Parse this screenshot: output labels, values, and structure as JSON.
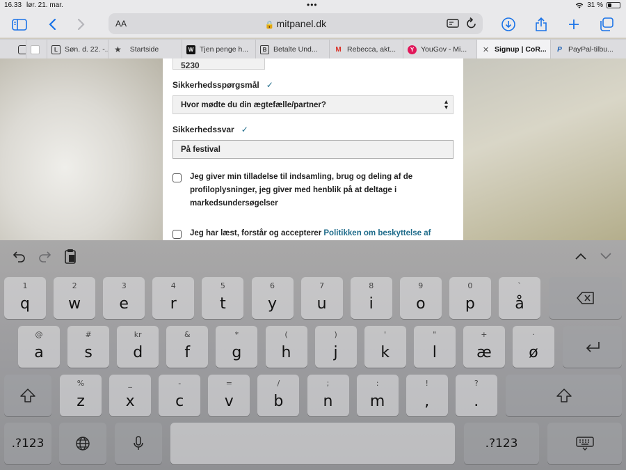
{
  "status": {
    "time": "16.33",
    "date": "lør. 21. mar.",
    "battery": "31 %",
    "battery_level": 0.31
  },
  "toolbar": {
    "text_size_label": "AA",
    "url": "mitpanel.dk"
  },
  "tabs": [
    {
      "label": "",
      "icon": "generic-favicon"
    },
    {
      "label": "",
      "icon": "site-favicon"
    },
    {
      "label": "Søn. d. 22. -...",
      "icon": "L"
    },
    {
      "label": "Startside",
      "icon": "star-icon"
    },
    {
      "label": "Tjen penge h...",
      "icon": "W"
    },
    {
      "label": "Betalte Und...",
      "icon": "B"
    },
    {
      "label": "Rebecca, akt...",
      "icon": "gmail-icon"
    },
    {
      "label": "YouGov - Mi...",
      "icon": "Y"
    },
    {
      "label": "Signup | CoR...",
      "icon": "close-icon"
    },
    {
      "label": "PayPal-tilbu...",
      "icon": "paypal-icon"
    }
  ],
  "form": {
    "zip_value": "5230",
    "security_question_label": "Sikkerhedsspørgsmål",
    "security_question_value": "Hvor mødte du din ægtefælle/partner?",
    "security_answer_label": "Sikkerhedssvar",
    "security_answer_value": "På festival",
    "consent_text": "Jeg giver min tilladelse til indsamling, brug og deling af de profiloplysninger, jeg giver med henblik på at deltage i markedsundersøgelser",
    "privacy_text": "Jeg har læst, forstår og accepterer ",
    "privacy_link": "Politikken om beskyttelse af"
  },
  "keyboard": {
    "row1": [
      {
        "k": "q",
        "a": "1"
      },
      {
        "k": "w",
        "a": "2"
      },
      {
        "k": "e",
        "a": "3"
      },
      {
        "k": "r",
        "a": "4"
      },
      {
        "k": "t",
        "a": "5"
      },
      {
        "k": "y",
        "a": "6"
      },
      {
        "k": "u",
        "a": "7"
      },
      {
        "k": "i",
        "a": "8"
      },
      {
        "k": "o",
        "a": "9"
      },
      {
        "k": "p",
        "a": "0"
      },
      {
        "k": "å",
        "a": "`"
      }
    ],
    "row2": [
      {
        "k": "a",
        "a": "@"
      },
      {
        "k": "s",
        "a": "#"
      },
      {
        "k": "d",
        "a": "kr"
      },
      {
        "k": "f",
        "a": "&"
      },
      {
        "k": "g",
        "a": "*"
      },
      {
        "k": "h",
        "a": "("
      },
      {
        "k": "j",
        "a": ")"
      },
      {
        "k": "k",
        "a": "'"
      },
      {
        "k": "l",
        "a": "\""
      },
      {
        "k": "æ",
        "a": "+"
      },
      {
        "k": "ø",
        "a": "·"
      }
    ],
    "row3": [
      {
        "k": "z",
        "a": "%"
      },
      {
        "k": "x",
        "a": "_"
      },
      {
        "k": "c",
        "a": "-"
      },
      {
        "k": "v",
        "a": "="
      },
      {
        "k": "b",
        "a": "/"
      },
      {
        "k": "n",
        "a": ";"
      },
      {
        "k": "m",
        "a": ":"
      },
      {
        "k": ",",
        "a": "!"
      },
      {
        "k": ".",
        "a": "?"
      }
    ],
    "numbers_label": ".?123"
  }
}
